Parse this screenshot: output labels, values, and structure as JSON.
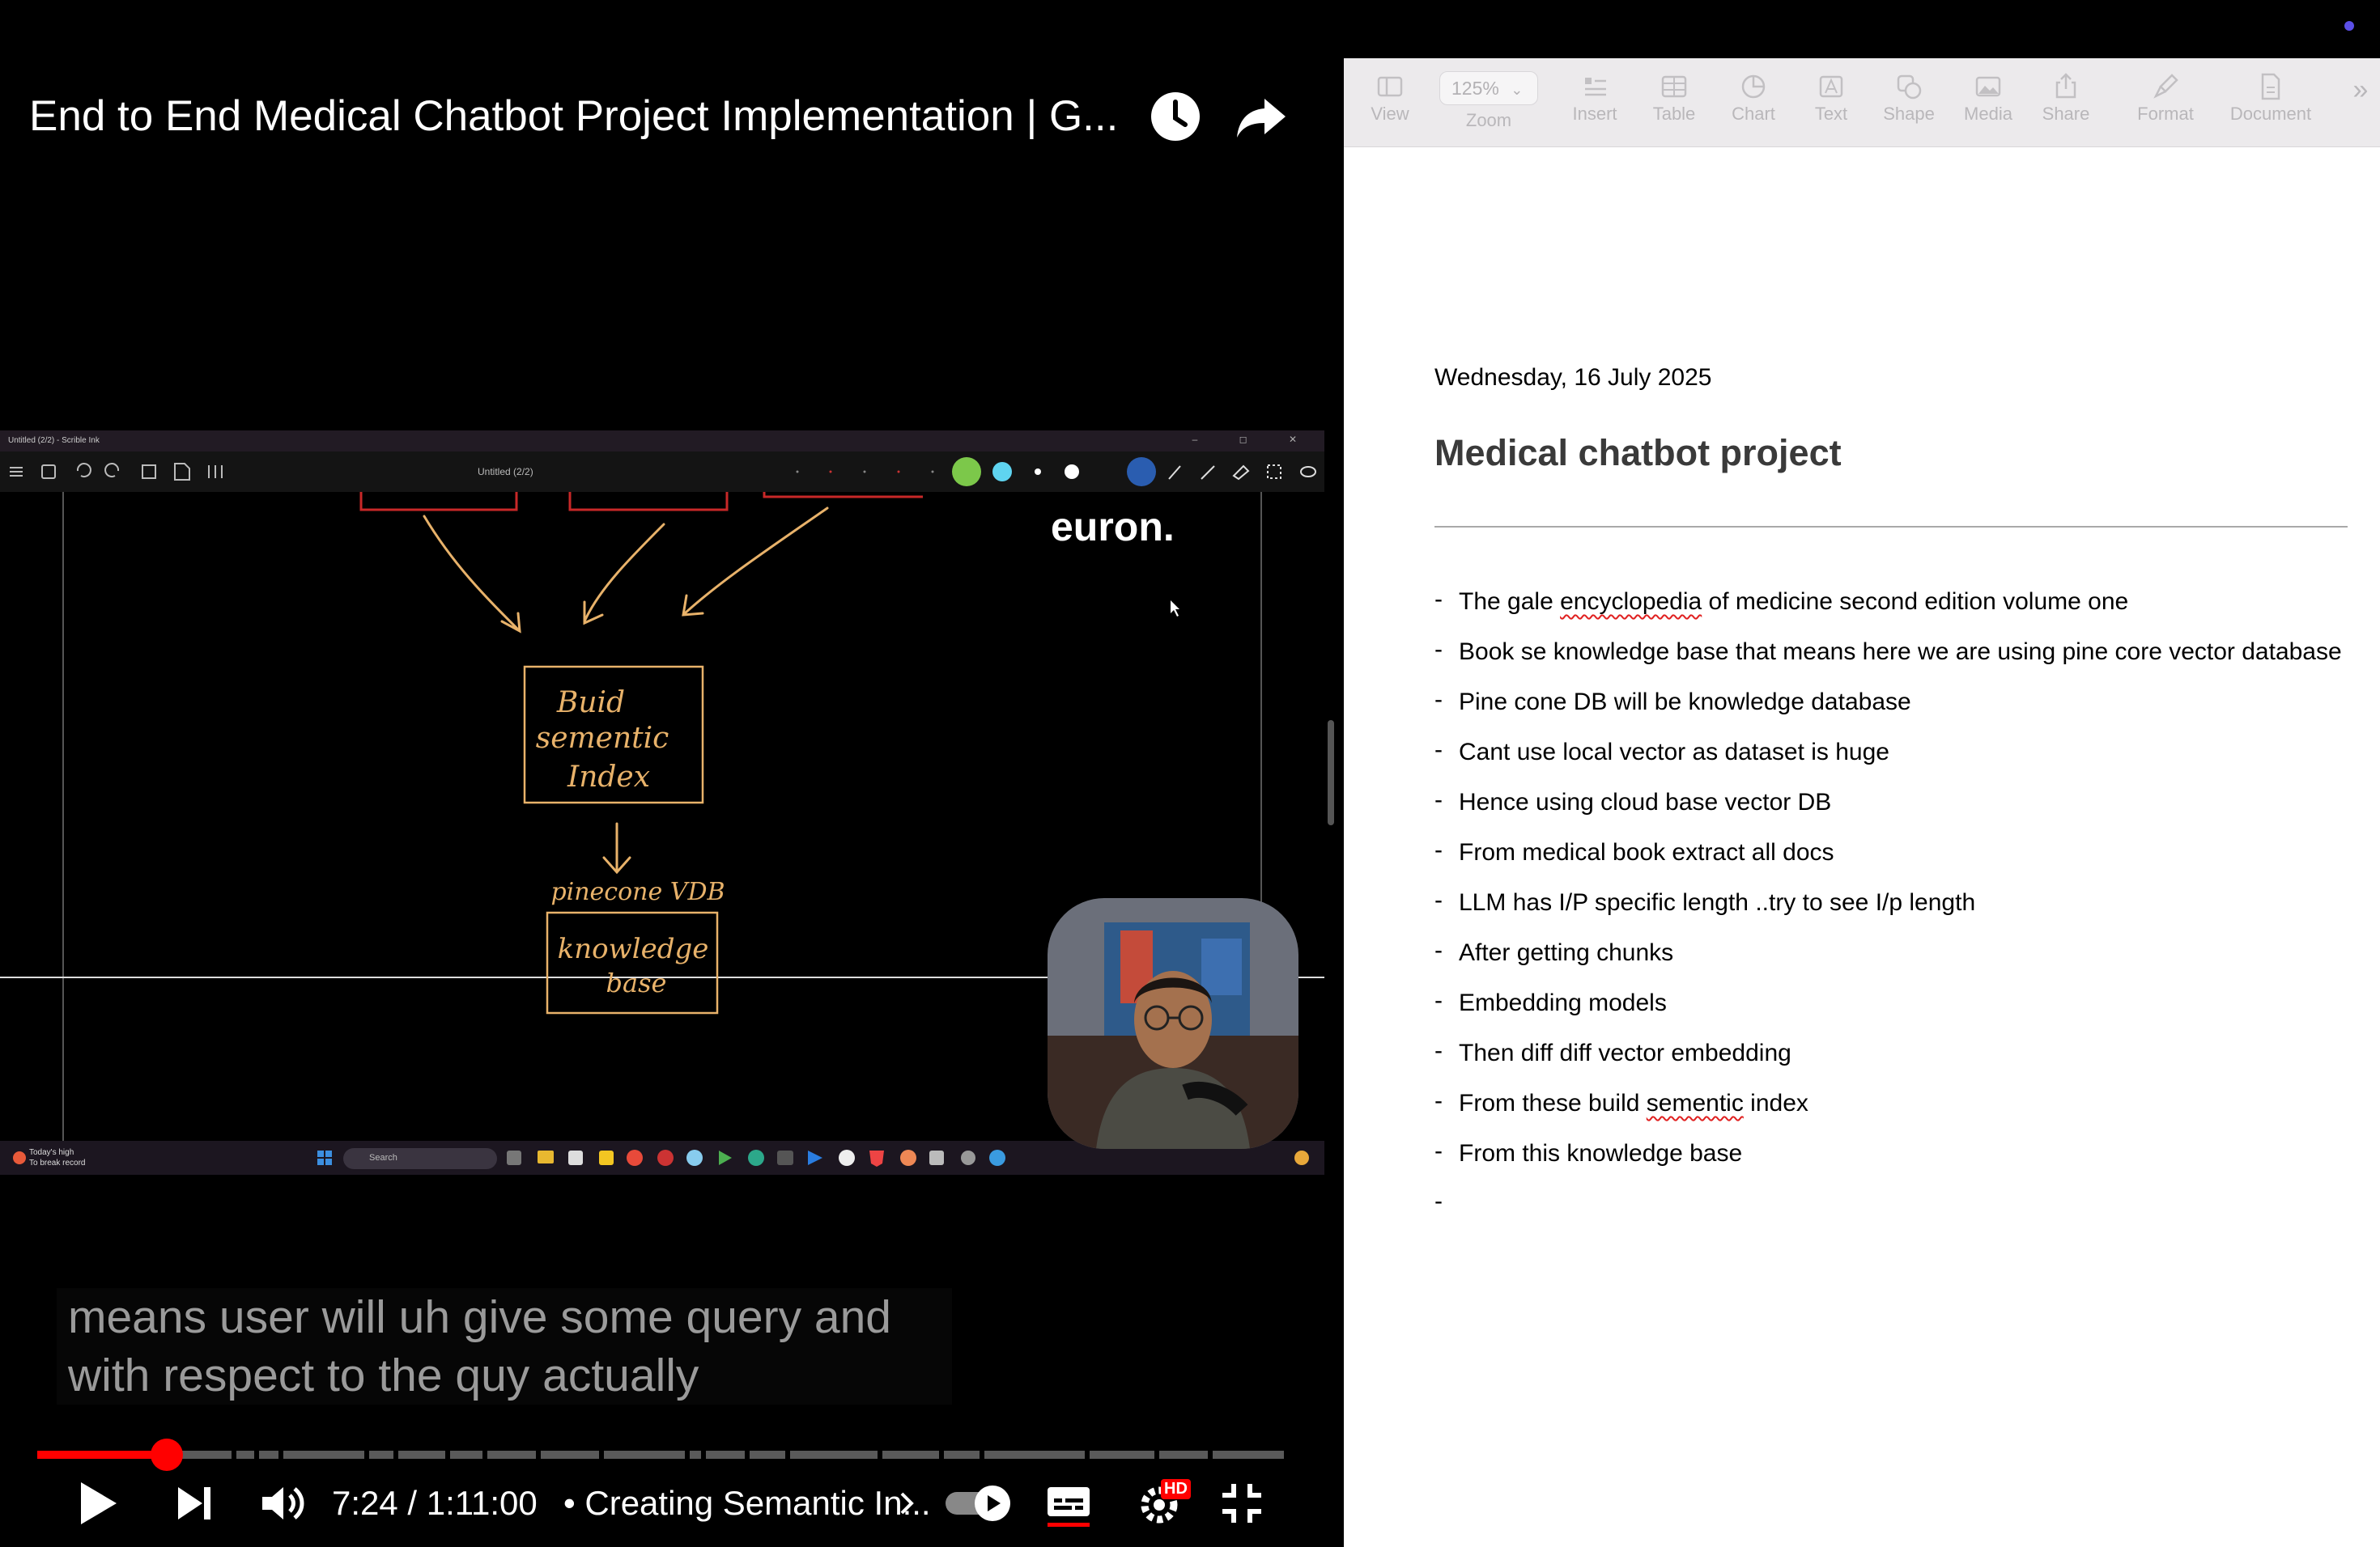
{
  "video": {
    "title": "End to End Medical Chatbot Project Implementation | G...",
    "capture": {
      "window_title": "Untitled (2/2) - Scrible Ink",
      "doc_title": "Untitled (2/2)",
      "window_buttons": "– ◻ ✕",
      "logo": "euron.",
      "whiteboard": {
        "box1": [
          "Buid",
          "sementic",
          "Index"
        ],
        "label": "pinecone VDB",
        "box2": [
          "knowledge",
          "base"
        ]
      },
      "taskbar": {
        "weather_line1": "Today's high",
        "weather_line2": "To break record",
        "search": "Search"
      }
    },
    "captions": [
      "means user will uh give some query and",
      "with respect to the quy actually"
    ],
    "controls": {
      "time": "7:24 / 1:11:00",
      "chapter": "• Creating Semantic In...",
      "progress_fraction": 0.104,
      "hd_badge": "HD",
      "icons": [
        "play-icon",
        "next-icon",
        "volume-icon",
        "chevron-right-icon",
        "autoplay-toggle",
        "captions-icon",
        "settings-icon",
        "exit-fullscreen-icon"
      ]
    },
    "icons": [
      "watch-later-icon",
      "share-icon"
    ]
  },
  "pages": {
    "toolbar": {
      "zoom_value": "125%",
      "items": [
        "View",
        "Zoom",
        "Insert",
        "Table",
        "Chart",
        "Text",
        "Shape",
        "Media",
        "Share",
        "Format",
        "Document"
      ],
      "more": "»"
    },
    "doc": {
      "date": "Wednesday, 16 July 2025",
      "title": "Medical chatbot project",
      "bullets": [
        "The gale encyclopedia of medicine second edition volume one",
        "Book se knowledge base that means here we are using pine core vector database",
        "Pine cone DB will be knowledge database",
        "Cant use local vector as dataset is huge",
        "Hence using cloud base vector DB",
        "From medical book extract all docs",
        "LLM has I/P specific length ..try to see I/p length",
        "After getting chunks",
        "Embedding models",
        "Then diff diff vector embedding",
        "From these build sementic index",
        "From this knowledge base",
        ""
      ]
    }
  },
  "colors": {
    "accent_red": "#ff0000",
    "ink_orange": "#e8b26a",
    "pages_bg": "#ffffff",
    "toolbar_bg": "#eceaec"
  }
}
